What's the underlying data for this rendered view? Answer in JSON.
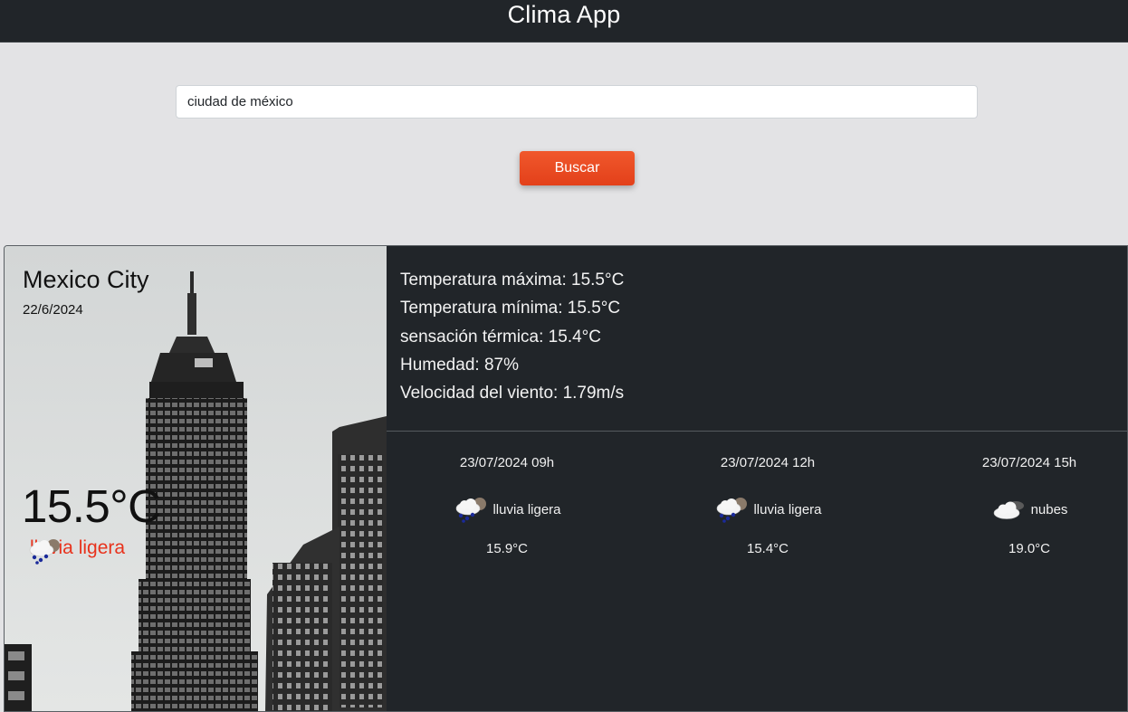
{
  "app": {
    "title": "Clima App"
  },
  "search": {
    "value": "ciudad de méxico",
    "button_label": "Buscar"
  },
  "current": {
    "city": "Mexico City",
    "date": "22/6/2024",
    "temperature": "15.5°C",
    "condition": "lluvia ligera",
    "condition_icon": "light-rain-icon",
    "condition_color": "#e8321c"
  },
  "details": {
    "max_temp": "Temperatura máxima: 15.5°C",
    "min_temp": "Temperatura mínima: 15.5°C",
    "feels_like": "sensación térmica: 15.4°C",
    "humidity": "Humedad: 87%",
    "wind": "Velocidad del viento: 1.79m/s"
  },
  "forecast": [
    {
      "datetime": "23/07/2024 09h",
      "condition": "lluvia ligera",
      "icon": "light-rain-icon",
      "temp": "15.9°C"
    },
    {
      "datetime": "23/07/2024 12h",
      "condition": "lluvia ligera",
      "icon": "light-rain-icon",
      "temp": "15.4°C"
    },
    {
      "datetime": "23/07/2024 15h",
      "condition": "nubes",
      "icon": "cloud-icon",
      "temp": "19.0°C"
    }
  ],
  "colors": {
    "header_bg": "#212529",
    "accent": "#e3401a",
    "card_bg": "#212529"
  }
}
